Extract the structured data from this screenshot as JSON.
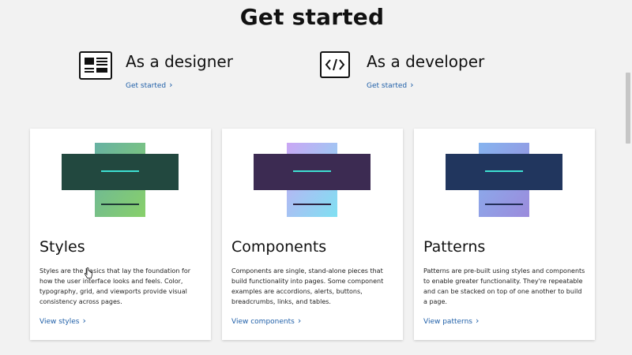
{
  "page": {
    "title": "Get started"
  },
  "intro": [
    {
      "title": "As a designer",
      "link": "Get started",
      "icon": "layout-icon"
    },
    {
      "title": "As a developer",
      "link": "Get started",
      "icon": "code-icon"
    }
  ],
  "cards": [
    {
      "title": "Styles",
      "description": "Styles are the basics that lay the foundation for how the user interface looks and feels. Color, typography, grid, and viewports provide visual consistency across pages.",
      "link": "View styles",
      "colors": {
        "band": "#22483f",
        "vertical_top": "#67b1a3",
        "vertical_bottom": "#88d06a",
        "line_top": "#3ee0d2",
        "line_bottom": "#1f3b36"
      }
    },
    {
      "title": "Components",
      "description": "Components are single, stand-alone pieces that build functionality into pages. Some component examples are accordions, alerts, buttons, breadcrumbs, links, and tables.",
      "link": "View components",
      "colors": {
        "band": "#3c2b52",
        "vertical_top": "#caa6f4",
        "vertical_bottom": "#7fe0f2",
        "line_top": "#3ee0d2",
        "line_bottom": "#2d2442"
      }
    },
    {
      "title": "Patterns",
      "description": "Patterns are pre-built using styles and components to enable greater functionality. They're repeatable and can be stacked on top of one another to build a page.",
      "link": "View patterns",
      "colors": {
        "band": "#21365e",
        "vertical_top": "#86b4ef",
        "vertical_bottom": "#9b8bdc",
        "line_top": "#3ee0d2",
        "line_bottom": "#232f58"
      }
    }
  ],
  "theme": {
    "background": "#f2f2f2",
    "link_color": "#1f5fa8",
    "card_background": "#ffffff"
  }
}
